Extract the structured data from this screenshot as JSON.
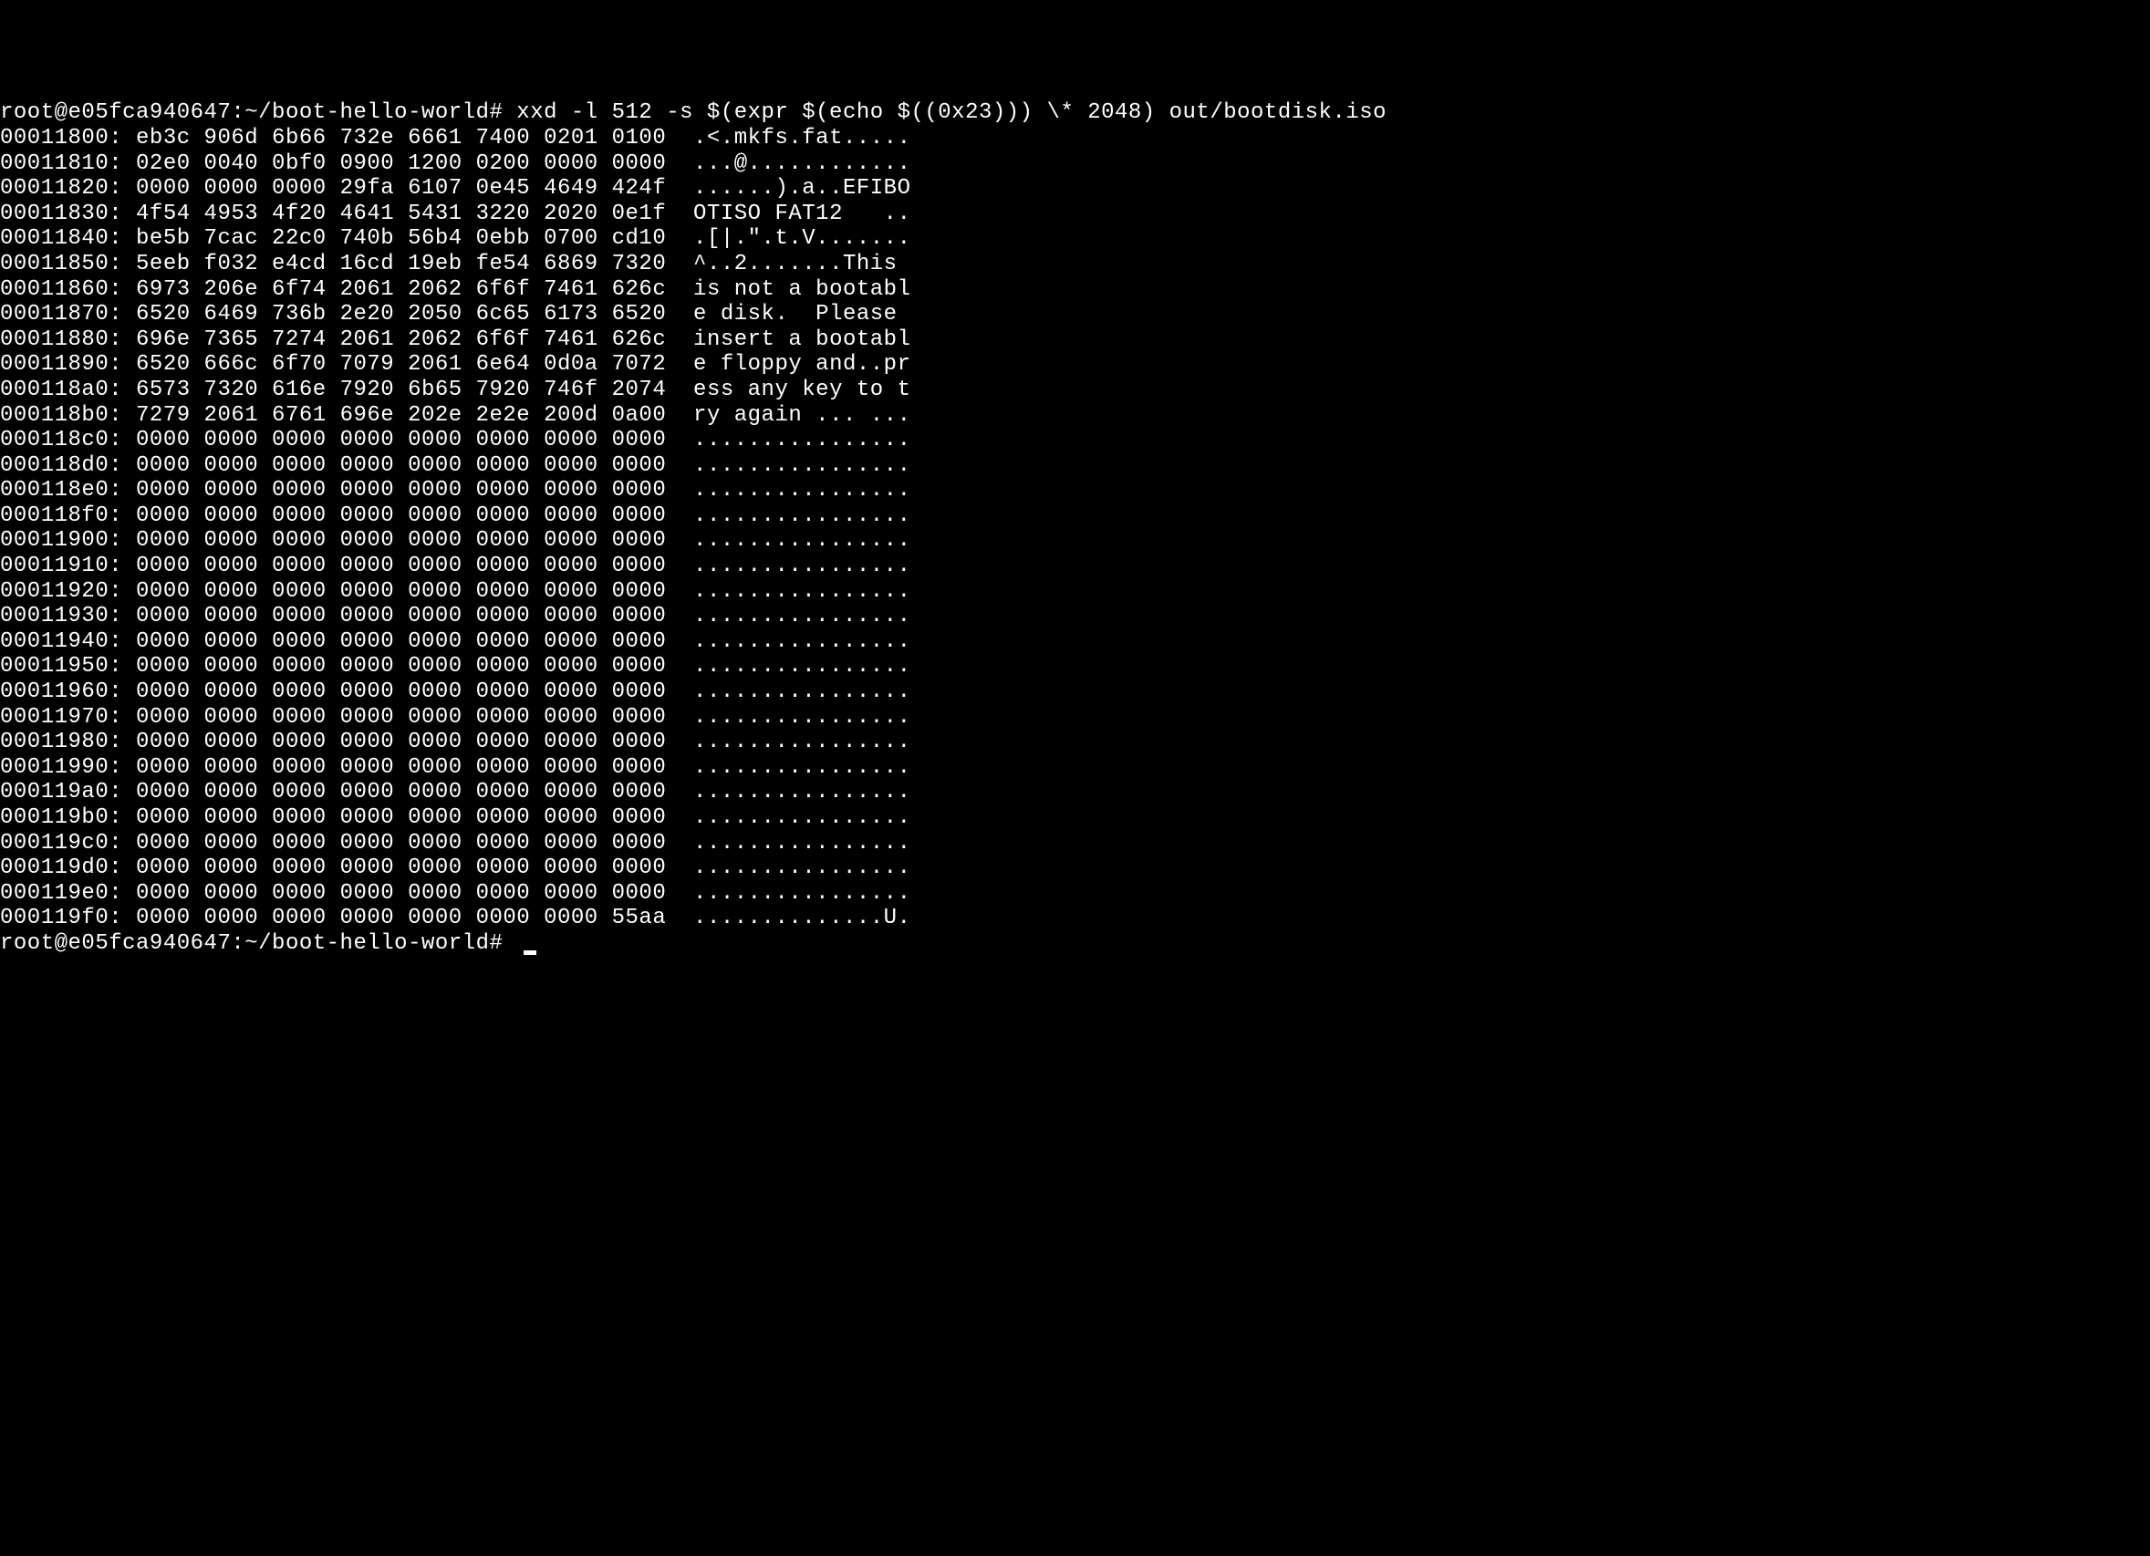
{
  "prompt1": "root@e05fca940647:~/boot-hello-world# ",
  "command": "xxd -l 512 -s $(expr $(echo $((0x23))) \\* 2048) out/bootdisk.iso",
  "hexdump": [
    {
      "offset": "00011800",
      "hex": "eb3c 906d 6b66 732e 6661 7400 0201 0100",
      "ascii": ".<.mkfs.fat....."
    },
    {
      "offset": "00011810",
      "hex": "02e0 0040 0bf0 0900 1200 0200 0000 0000",
      "ascii": "...@............"
    },
    {
      "offset": "00011820",
      "hex": "0000 0000 0000 29fa 6107 0e45 4649 424f",
      "ascii": "......).a..EFIBO"
    },
    {
      "offset": "00011830",
      "hex": "4f54 4953 4f20 4641 5431 3220 2020 0e1f",
      "ascii": "OTISO FAT12   .."
    },
    {
      "offset": "00011840",
      "hex": "be5b 7cac 22c0 740b 56b4 0ebb 0700 cd10",
      "ascii": ".[|.\".t.V......."
    },
    {
      "offset": "00011850",
      "hex": "5eeb f032 e4cd 16cd 19eb fe54 6869 7320",
      "ascii": "^..2.......This "
    },
    {
      "offset": "00011860",
      "hex": "6973 206e 6f74 2061 2062 6f6f 7461 626c",
      "ascii": "is not a bootabl"
    },
    {
      "offset": "00011870",
      "hex": "6520 6469 736b 2e20 2050 6c65 6173 6520",
      "ascii": "e disk.  Please "
    },
    {
      "offset": "00011880",
      "hex": "696e 7365 7274 2061 2062 6f6f 7461 626c",
      "ascii": "insert a bootabl"
    },
    {
      "offset": "00011890",
      "hex": "6520 666c 6f70 7079 2061 6e64 0d0a 7072",
      "ascii": "e floppy and..pr"
    },
    {
      "offset": "000118a0",
      "hex": "6573 7320 616e 7920 6b65 7920 746f 2074",
      "ascii": "ess any key to t"
    },
    {
      "offset": "000118b0",
      "hex": "7279 2061 6761 696e 202e 2e2e 200d 0a00",
      "ascii": "ry again ... ..."
    },
    {
      "offset": "000118c0",
      "hex": "0000 0000 0000 0000 0000 0000 0000 0000",
      "ascii": "................"
    },
    {
      "offset": "000118d0",
      "hex": "0000 0000 0000 0000 0000 0000 0000 0000",
      "ascii": "................"
    },
    {
      "offset": "000118e0",
      "hex": "0000 0000 0000 0000 0000 0000 0000 0000",
      "ascii": "................"
    },
    {
      "offset": "000118f0",
      "hex": "0000 0000 0000 0000 0000 0000 0000 0000",
      "ascii": "................"
    },
    {
      "offset": "00011900",
      "hex": "0000 0000 0000 0000 0000 0000 0000 0000",
      "ascii": "................"
    },
    {
      "offset": "00011910",
      "hex": "0000 0000 0000 0000 0000 0000 0000 0000",
      "ascii": "................"
    },
    {
      "offset": "00011920",
      "hex": "0000 0000 0000 0000 0000 0000 0000 0000",
      "ascii": "................"
    },
    {
      "offset": "00011930",
      "hex": "0000 0000 0000 0000 0000 0000 0000 0000",
      "ascii": "................"
    },
    {
      "offset": "00011940",
      "hex": "0000 0000 0000 0000 0000 0000 0000 0000",
      "ascii": "................"
    },
    {
      "offset": "00011950",
      "hex": "0000 0000 0000 0000 0000 0000 0000 0000",
      "ascii": "................"
    },
    {
      "offset": "00011960",
      "hex": "0000 0000 0000 0000 0000 0000 0000 0000",
      "ascii": "................"
    },
    {
      "offset": "00011970",
      "hex": "0000 0000 0000 0000 0000 0000 0000 0000",
      "ascii": "................"
    },
    {
      "offset": "00011980",
      "hex": "0000 0000 0000 0000 0000 0000 0000 0000",
      "ascii": "................"
    },
    {
      "offset": "00011990",
      "hex": "0000 0000 0000 0000 0000 0000 0000 0000",
      "ascii": "................"
    },
    {
      "offset": "000119a0",
      "hex": "0000 0000 0000 0000 0000 0000 0000 0000",
      "ascii": "................"
    },
    {
      "offset": "000119b0",
      "hex": "0000 0000 0000 0000 0000 0000 0000 0000",
      "ascii": "................"
    },
    {
      "offset": "000119c0",
      "hex": "0000 0000 0000 0000 0000 0000 0000 0000",
      "ascii": "................"
    },
    {
      "offset": "000119d0",
      "hex": "0000 0000 0000 0000 0000 0000 0000 0000",
      "ascii": "................"
    },
    {
      "offset": "000119e0",
      "hex": "0000 0000 0000 0000 0000 0000 0000 0000",
      "ascii": "................"
    },
    {
      "offset": "000119f0",
      "hex": "0000 0000 0000 0000 0000 0000 0000 55aa",
      "ascii": "..............U."
    }
  ],
  "prompt2": "root@e05fca940647:~/boot-hello-world# "
}
